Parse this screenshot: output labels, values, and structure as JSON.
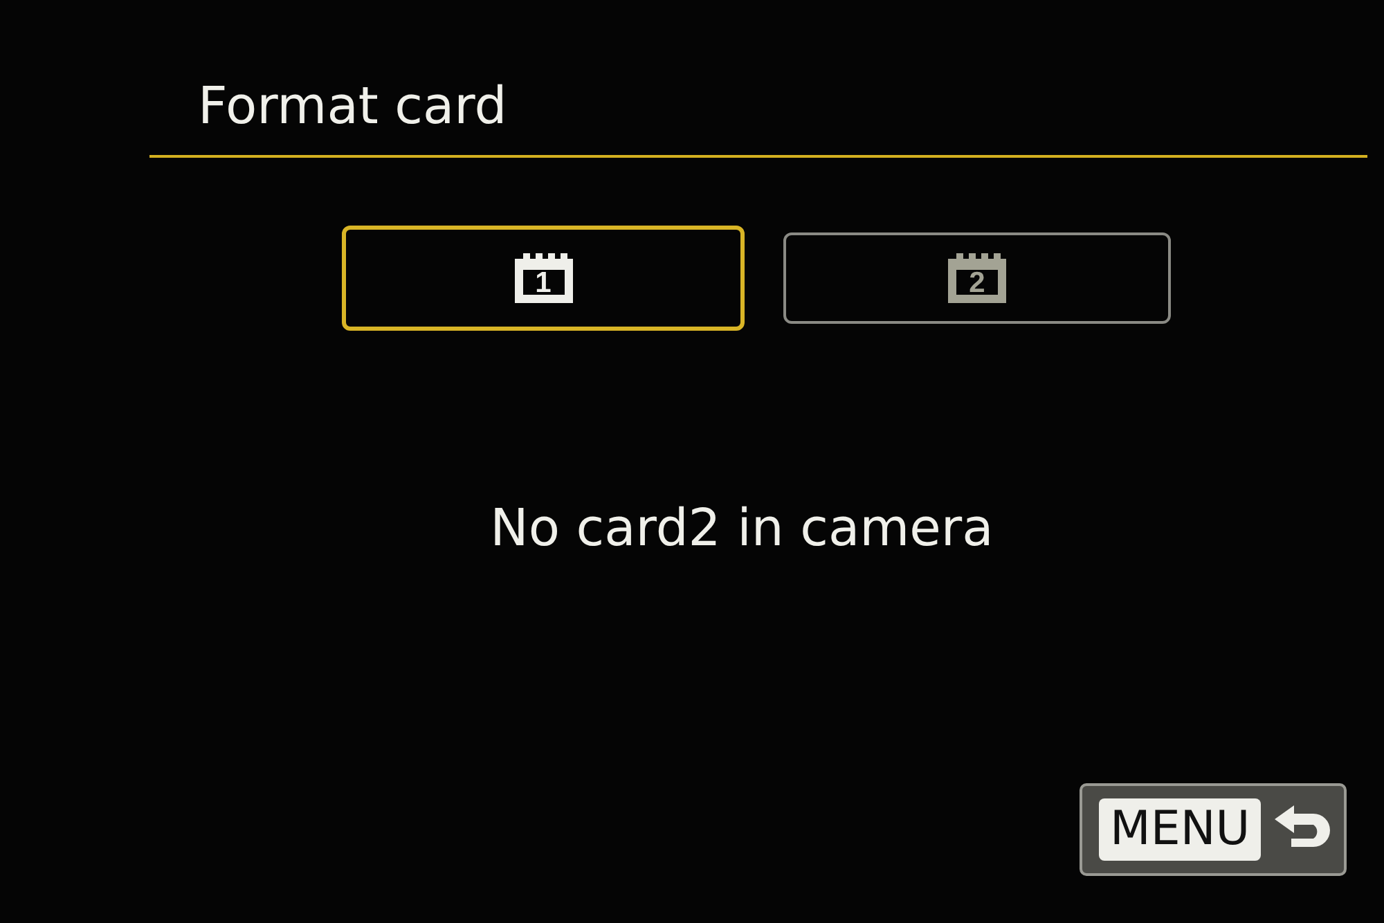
{
  "title": "Format card",
  "cards": [
    {
      "label": "1",
      "selected": true,
      "disabled": false
    },
    {
      "label": "2",
      "selected": false,
      "disabled": true
    }
  ],
  "message": "No card2 in camera",
  "menu_button": {
    "label": "MENU"
  }
}
